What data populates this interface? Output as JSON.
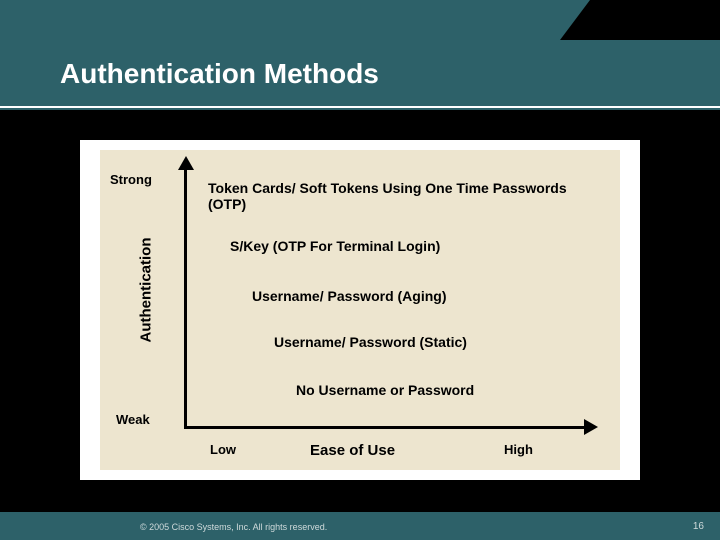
{
  "title": "Authentication Methods",
  "axes": {
    "y_label": "Authentication",
    "y_top": "Strong",
    "y_bottom": "Weak",
    "x_label": "Ease of Use",
    "x_left": "Low",
    "x_right": "High"
  },
  "methods": [
    "Token Cards/ Soft Tokens Using One Time Passwords (OTP)",
    "S/Key (OTP For Terminal Login)",
    "Username/ Password (Aging)",
    "Username/ Password (Static)",
    "No Username or Password"
  ],
  "footer": {
    "copyright": "© 2005 Cisco Systems, Inc. All rights reserved.",
    "page": "16"
  }
}
